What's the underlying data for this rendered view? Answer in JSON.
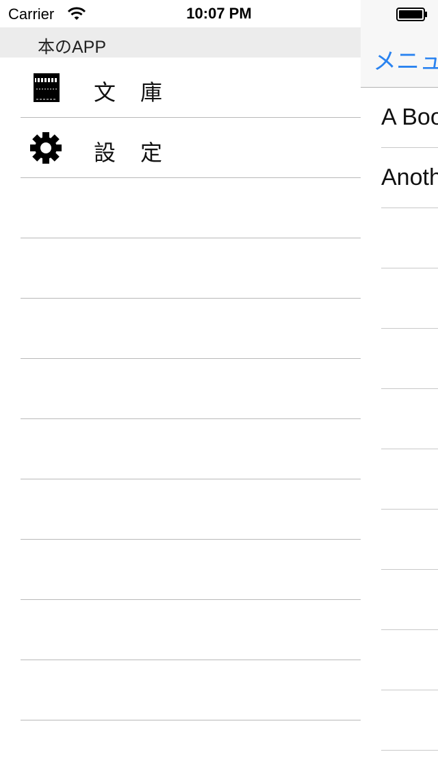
{
  "status_bar": {
    "carrier": "Carrier",
    "time": "10:07 PM",
    "wifi_icon": "wifi-icon",
    "battery_icon": "battery-icon"
  },
  "menu": {
    "title": "本のAPP",
    "items": [
      {
        "label": "文庫",
        "icon": "bookshelf-icon"
      },
      {
        "label": "設定",
        "icon": "gear-icon"
      }
    ],
    "empty_rows": 9
  },
  "content": {
    "back_button": "メニュー",
    "items": [
      {
        "label": "A Book"
      },
      {
        "label": "Another"
      }
    ],
    "empty_rows": 9
  },
  "colors": {
    "accent": "#2a83f0",
    "header_bg": "#ececec",
    "separator": "#b8b8b8"
  }
}
